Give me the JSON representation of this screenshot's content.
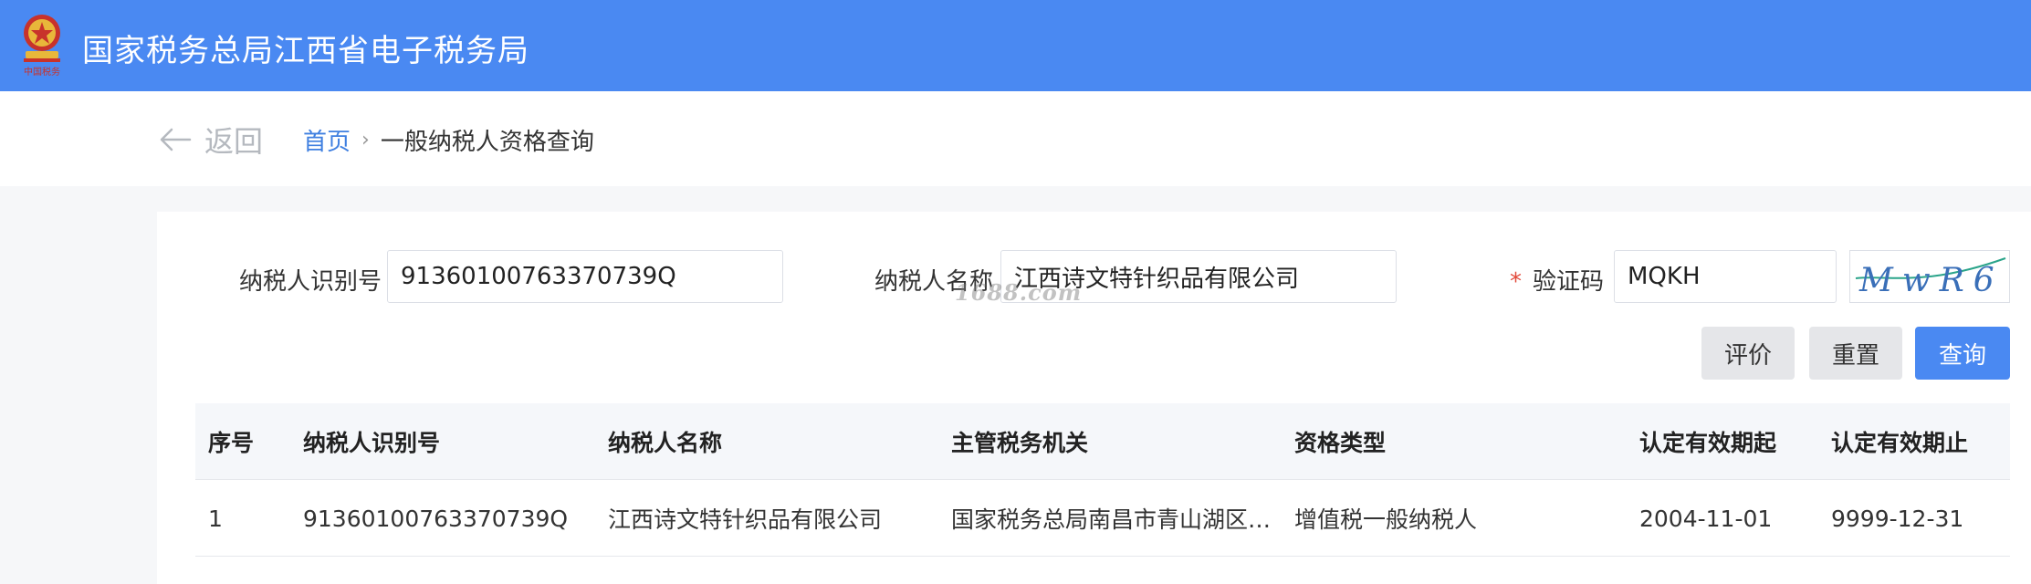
{
  "header": {
    "site_title": "国家税务总局江西省电子税务局",
    "emblem_caption": "中国税务"
  },
  "nav": {
    "back_label": "返回",
    "breadcrumb": {
      "home": "首页",
      "separator": "›",
      "current": "一般纳税人资格查询"
    }
  },
  "form": {
    "taxpayer_id_label": "纳税人识别号",
    "taxpayer_id_value": "91360100763370739Q",
    "taxpayer_name_label": "纳税人名称",
    "taxpayer_name_value": "江西诗文特针织品有限公司",
    "captcha_required_mark": "*",
    "captcha_label": "验证码",
    "captcha_value": "MQKH",
    "captcha_image_text": "MwR6"
  },
  "buttons": {
    "evaluate": "评价",
    "reset": "重置",
    "query": "查询"
  },
  "table": {
    "headers": [
      "序号",
      "纳税人识别号",
      "纳税人名称",
      "主管税务机关",
      "资格类型",
      "认定有效期起",
      "认定有效期止"
    ],
    "rows": [
      [
        "1",
        "91360100763370739Q",
        "江西诗文特针织品有限公司",
        "国家税务总局南昌市青山湖区…",
        "增值税一般纳税人",
        "2004-11-01",
        "9999-12-31"
      ]
    ]
  },
  "watermark": "1688.com",
  "colors": {
    "brand_blue": "#4a89f2",
    "link_blue": "#3f7fe0",
    "required_red": "#e24a3b"
  }
}
